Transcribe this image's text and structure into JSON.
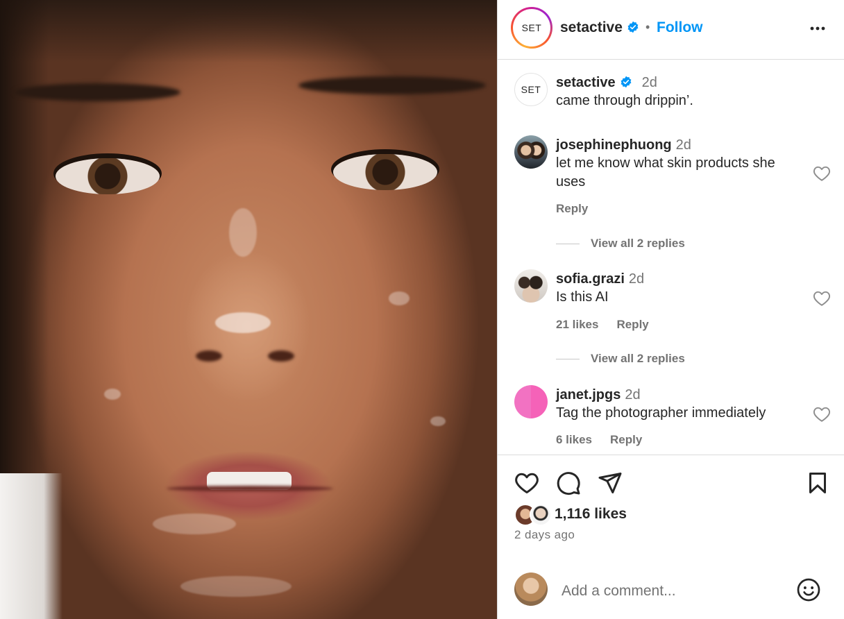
{
  "post": {
    "username": "setactive",
    "avatar_text": "SET",
    "follow_label": "Follow",
    "separator": "•",
    "caption": {
      "username": "setactive",
      "time": "2d",
      "text": "came through drippin’."
    }
  },
  "comments": [
    {
      "username": "josephinephuong",
      "time": "2d",
      "text": "let me know what skin products she uses",
      "likes": "",
      "reply_label": "Reply",
      "view_replies": "View all 2 replies"
    },
    {
      "username": "sofia.grazi",
      "time": "2d",
      "text": "Is this AI",
      "likes": "21 likes",
      "reply_label": "Reply",
      "view_replies": "View all 2 replies"
    },
    {
      "username": "janet.jpgs",
      "time": "2d",
      "text": "Tag the photographer immediately",
      "likes": "6 likes",
      "reply_label": "Reply"
    }
  ],
  "footer": {
    "likes": "1,116 likes",
    "posted": "2 days ago",
    "comment_placeholder": "Add a comment..."
  },
  "icons": {
    "verified": "verified-badge-icon",
    "more": "more-options-icon",
    "like": "heart-icon",
    "comment": "comment-bubble-icon",
    "share": "paper-plane-icon",
    "save": "bookmark-icon",
    "emoji": "smiley-icon"
  },
  "colors": {
    "accent": "#0095f6",
    "verified": "#0095f6",
    "text": "#262626",
    "muted": "#737373",
    "janet_avatar": "#f272c2"
  }
}
